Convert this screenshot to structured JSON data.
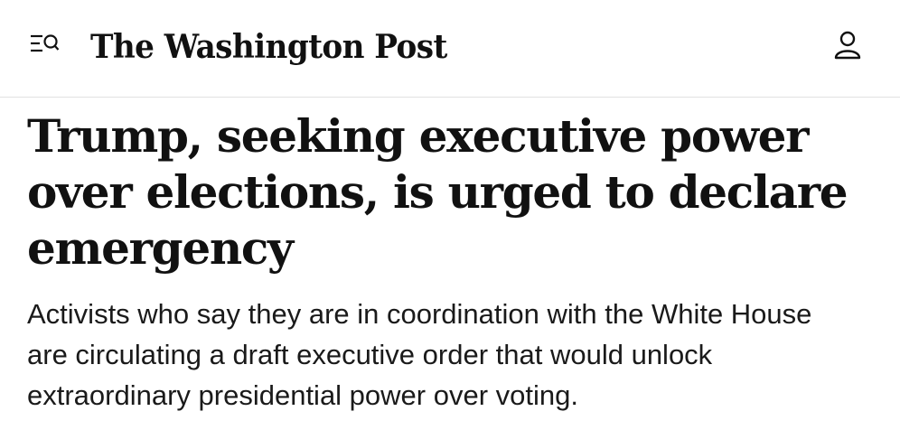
{
  "header": {
    "menu_icon": "menu-search-icon",
    "masthead": "The Washington Post",
    "account_icon": "user-icon"
  },
  "article": {
    "headline": "Trump, seeking executive power over elections, is urged to declare emergency",
    "subhead": "Activists who say they are in coordination with the White House are circulating a draft executive order that would unlock extraordinary presidential power over voting."
  }
}
